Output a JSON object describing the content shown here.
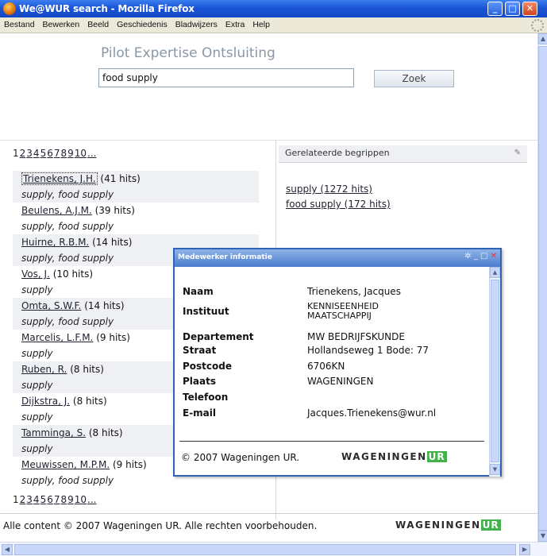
{
  "window": {
    "title": "We@WUR search - Mozilla Firefox",
    "controls": {
      "minimize": "_",
      "maximize": "□",
      "close": "✕"
    }
  },
  "menu": [
    "Bestand",
    "Bewerken",
    "Beeld",
    "Geschiedenis",
    "Bladwijzers",
    "Extra",
    "Help"
  ],
  "app": {
    "title": "Pilot Expertise Ontsluiting"
  },
  "search": {
    "value": "food supply",
    "button_label": "Zoek"
  },
  "pagination": {
    "current": "1",
    "pages": [
      "2",
      "3",
      "4",
      "5",
      "6",
      "7",
      "8",
      "9",
      "10"
    ],
    "more": "..."
  },
  "results": [
    {
      "name": "Trienekens, J.H.",
      "hits": "(41 hits)",
      "terms": "supply, food supply"
    },
    {
      "name": "Beulens, A.J.M.",
      "hits": "(39 hits)",
      "terms": "supply, food supply"
    },
    {
      "name": "Huirne, R.B.M.",
      "hits": "(14 hits)",
      "terms": "supply, food supply"
    },
    {
      "name": "Vos, J.",
      "hits": "(10 hits)",
      "terms": "supply"
    },
    {
      "name": "Omta, S.W.F.",
      "hits": "(14 hits)",
      "terms": "supply, food supply"
    },
    {
      "name": "Marcelis, L.F.M.",
      "hits": "(9 hits)",
      "terms": "supply"
    },
    {
      "name": "Ruben, R.",
      "hits": "(8 hits)",
      "terms": "supply"
    },
    {
      "name": "Dijkstra, J.",
      "hits": "(8 hits)",
      "terms": "supply"
    },
    {
      "name": "Tamminga, S.",
      "hits": "(8 hits)",
      "terms": "supply"
    },
    {
      "name": "Meuwissen, M.P.M.",
      "hits": "(9 hits)",
      "terms": "supply, food supply"
    }
  ],
  "related": {
    "header": "Gerelateerde begrippen",
    "items": [
      "supply (1272 hits)",
      "food supply (172 hits)"
    ]
  },
  "popup": {
    "title": "Medewerker informatie",
    "fields": [
      {
        "label": "Naam",
        "value": "Trienekens, Jacques"
      },
      {
        "label": "Instituut",
        "value": "KENNISEENHEID MAATSCHAPPIJ"
      },
      {
        "label": "Departement",
        "value": "MW BEDRIJFSKUNDE"
      },
      {
        "label": "Straat",
        "value": "Hollandseweg 1 Bode: 77"
      },
      {
        "label": "Postcode",
        "value": "6706KN"
      },
      {
        "label": "Plaats",
        "value": "WAGENINGEN"
      },
      {
        "label": "Telefoon",
        "value": ""
      },
      {
        "label": "E-mail",
        "value": "Jacques.Trienekens@wur.nl"
      }
    ],
    "copyright": "© 2007 Wageningen UR."
  },
  "logo": {
    "text": "WAGENINGEN",
    "suffix": "UR"
  },
  "footer": {
    "text": "Alle content © 2007 Wageningen UR. Alle rechten voorbehouden."
  },
  "colors": {
    "titlebar": "#1a55d6",
    "popup_border": "#2f63b5",
    "logo_green": "#44b24a"
  }
}
